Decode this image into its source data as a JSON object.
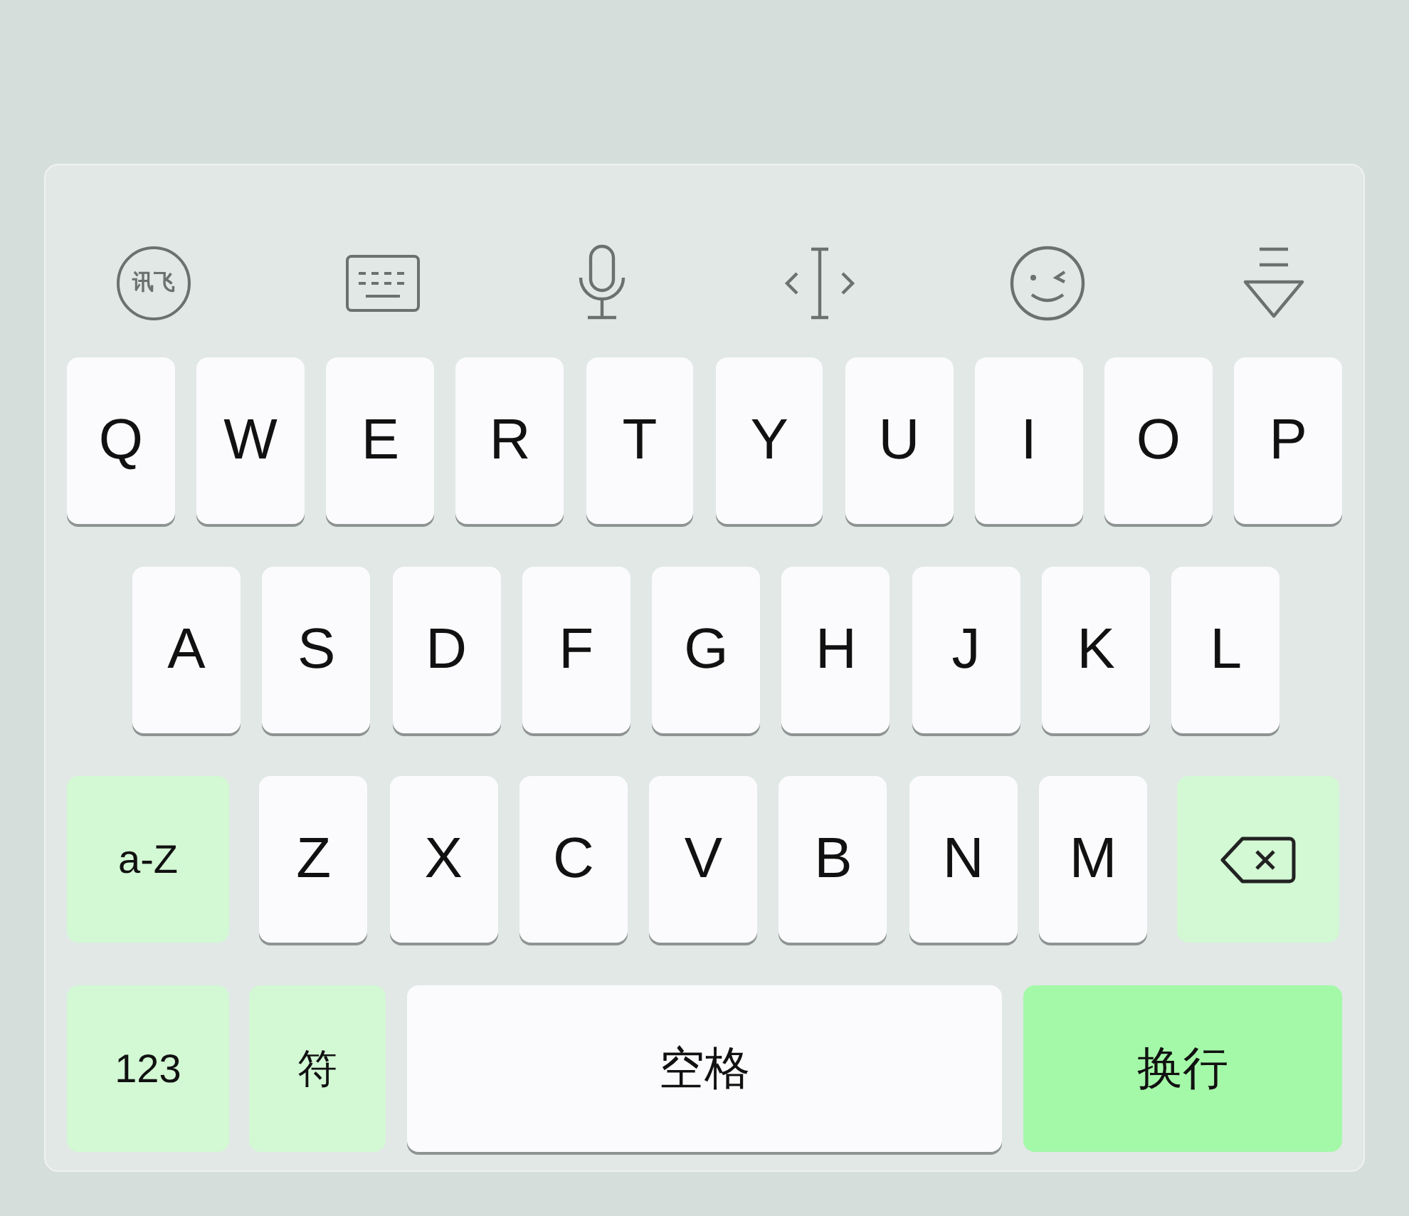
{
  "toolbar": [
    {
      "kind": "logo",
      "text": "讯飞"
    },
    {
      "kind": "keyboard"
    },
    {
      "kind": "microphone"
    },
    {
      "kind": "cursor"
    },
    {
      "kind": "emoji"
    },
    {
      "kind": "hide"
    }
  ],
  "rows": [
    [
      {
        "kind": "letter",
        "label": "Q"
      },
      {
        "kind": "letter",
        "label": "W"
      },
      {
        "kind": "letter",
        "label": "E"
      },
      {
        "kind": "letter",
        "label": "R"
      },
      {
        "kind": "letter",
        "label": "T"
      },
      {
        "kind": "letter",
        "label": "Y"
      },
      {
        "kind": "letter",
        "label": "U"
      },
      {
        "kind": "letter",
        "label": "I"
      },
      {
        "kind": "letter",
        "label": "O"
      },
      {
        "kind": "letter",
        "label": "P"
      }
    ],
    [
      {
        "kind": "letter",
        "label": "A"
      },
      {
        "kind": "letter",
        "label": "S"
      },
      {
        "kind": "letter",
        "label": "D"
      },
      {
        "kind": "letter",
        "label": "F"
      },
      {
        "kind": "letter",
        "label": "G"
      },
      {
        "kind": "letter",
        "label": "H"
      },
      {
        "kind": "letter",
        "label": "J"
      },
      {
        "kind": "letter",
        "label": "K"
      },
      {
        "kind": "letter",
        "label": "L"
      }
    ],
    [
      {
        "kind": "shift",
        "label": "a-Z"
      },
      {
        "kind": "letter",
        "label": "Z"
      },
      {
        "kind": "letter",
        "label": "X"
      },
      {
        "kind": "letter",
        "label": "C"
      },
      {
        "kind": "letter",
        "label": "V"
      },
      {
        "kind": "letter",
        "label": "B"
      },
      {
        "kind": "letter",
        "label": "N"
      },
      {
        "kind": "letter",
        "label": "M"
      },
      {
        "kind": "backspace"
      }
    ],
    [
      {
        "kind": "numbers",
        "label": "123"
      },
      {
        "kind": "symbols",
        "label": "符"
      },
      {
        "kind": "space",
        "label": "空格"
      },
      {
        "kind": "enter",
        "label": "换行"
      }
    ]
  ]
}
